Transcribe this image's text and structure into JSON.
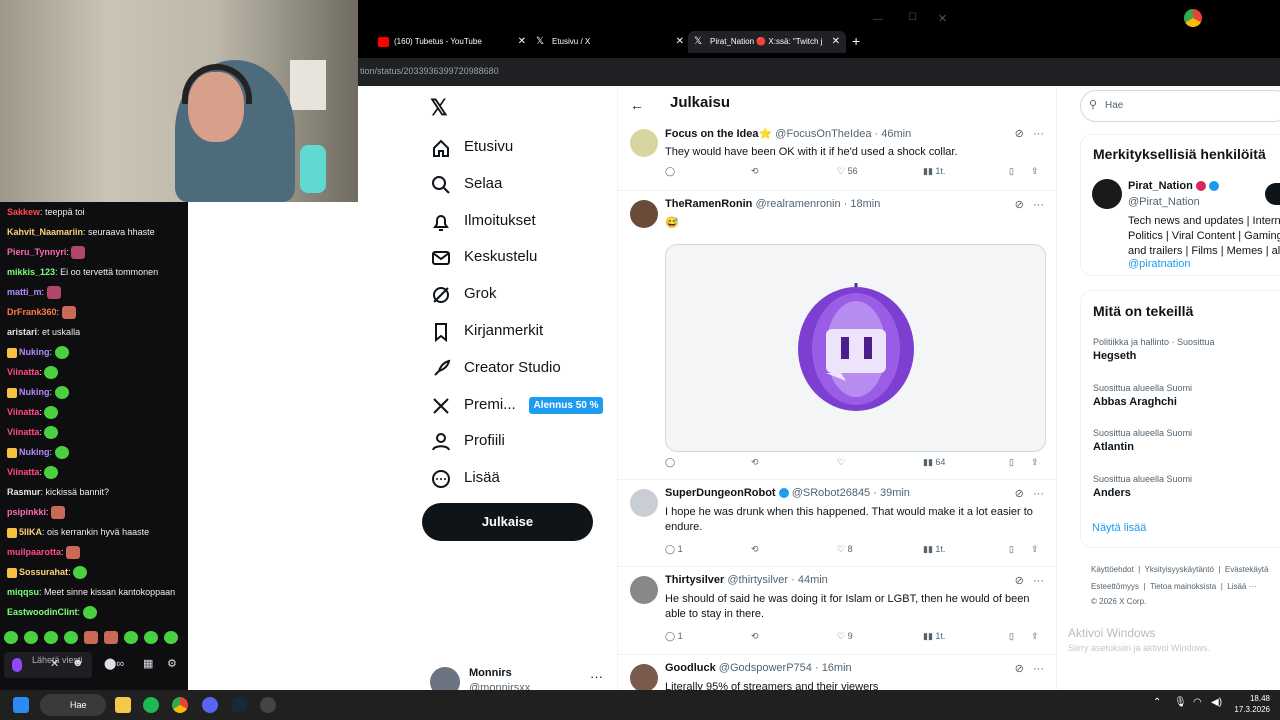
{
  "stream": {
    "chat": [
      {
        "user": "Sakkew",
        "color": "#ff4a4a",
        "text": "teeppä toi"
      },
      {
        "user": "Kahvit_Naamariin",
        "color": "#ffd27a",
        "text": "seuraava hhaste"
      },
      {
        "user": "Pieru_Tynnyri",
        "color": "#ff69b4",
        "text": ""
      },
      {
        "user": "mikkis_123",
        "color": "#7cff7c",
        "text": "Ei oo tervettä tommonen"
      },
      {
        "user": "matti_m",
        "color": "#b18cff",
        "text": ""
      },
      {
        "user": "DrFrank360",
        "color": "#ff7b4a",
        "text": ""
      },
      {
        "user": "aristari",
        "color": "#e6e6e6",
        "text": "et uskalla"
      },
      {
        "user": "Nuking",
        "color": "#b18cff",
        "text": ""
      },
      {
        "user": "Viinatta",
        "color": "#ff4a8a",
        "text": ""
      },
      {
        "user": "Nuking",
        "color": "#b18cff",
        "text": ""
      },
      {
        "user": "Viinatta",
        "color": "#ff4a8a",
        "text": ""
      },
      {
        "user": "Viinatta",
        "color": "#ff4a8a",
        "text": ""
      },
      {
        "user": "Nuking",
        "color": "#b18cff",
        "text": ""
      },
      {
        "user": "Viinatta",
        "color": "#ff4a8a",
        "text": ""
      },
      {
        "user": "Rasmur",
        "color": "#e6e6e6",
        "text": "kickissä bannit?"
      },
      {
        "user": "psipinkki",
        "color": "#ff69b4",
        "text": ""
      },
      {
        "user": "5IIKA",
        "color": "#ffd27a",
        "text": "ois kerrankin hyvä haaste"
      },
      {
        "user": "muilpaarotta",
        "color": "#ff4a8a",
        "text": ""
      },
      {
        "user": "Sossurahat",
        "color": "#ffd27a",
        "text": ""
      },
      {
        "user": "miqqsu",
        "color": "#7cff7c",
        "text": "Meet sinne kissan kantokoppaan"
      },
      {
        "user": "EastwoodinClint",
        "color": "#7cff7c",
        "text": ""
      }
    ],
    "send_placeholder": "Lähetä viesti"
  },
  "browser": {
    "tabs": [
      {
        "label": "(160) Tubetus - YouTube",
        "icon": "youtube-icon"
      },
      {
        "label": "Etusivu / X",
        "icon": "x-logo-icon"
      },
      {
        "label": "Pirat_Nation 🔴 X:ssä: \"Twitch j",
        "icon": "x-logo-icon"
      }
    ],
    "url": "tion/status/2033936399720988680"
  },
  "x": {
    "nav": [
      {
        "label": "Etusivu",
        "icon": "home-icon"
      },
      {
        "label": "Selaa",
        "icon": "search-icon"
      },
      {
        "label": "Ilmoitukset",
        "icon": "bell-icon"
      },
      {
        "label": "Keskustelu",
        "icon": "mail-icon"
      },
      {
        "label": "Grok",
        "icon": "grok-icon"
      },
      {
        "label": "Kirjanmerkit",
        "icon": "bookmark-icon"
      },
      {
        "label": "Creator Studio",
        "icon": "rocket-icon"
      },
      {
        "label": "Premi...",
        "icon": "x-logo-icon"
      },
      {
        "label": "Profiili",
        "icon": "person-icon"
      },
      {
        "label": "Lisää",
        "icon": "more-icon"
      }
    ],
    "premium_badge": "Alennus 50 %",
    "post_button": "Julkaise",
    "account": {
      "name": "Monnirs",
      "handle": "@monnirsxx"
    },
    "header_title": "Julkaisu",
    "tweets": [
      {
        "name": "Focus on the Idea⭐",
        "handle": "@FocusOnTheIdea",
        "time": "46min",
        "text": "They would have been OK with it if he'd used a shock collar.",
        "replies": "",
        "retweets": "",
        "likes": "56",
        "views": "1t."
      },
      {
        "name": "TheRamenRonin",
        "handle": "@realramenronin",
        "time": "18min",
        "text": "😅",
        "replies": "",
        "retweets": "",
        "likes": "",
        "views": "64"
      },
      {
        "name": "SuperDungeonRobot",
        "handle": "@SRobot26845",
        "time": "39min",
        "text": "I hope he was drunk when this happened. That would make it a lot easier to endure.",
        "replies": "1",
        "retweets": "",
        "likes": "8",
        "views": "1t."
      },
      {
        "name": "Thirtysilver",
        "handle": "@thirtysilver",
        "time": "44min",
        "text": "He should of said he was doing it for Islam or LGBT, then he would of been able to stay in there.",
        "replies": "1",
        "retweets": "",
        "likes": "9",
        "views": "1t."
      },
      {
        "name": "Goodluck",
        "handle": "@GodspowerP754",
        "time": "16min",
        "text": "Literally 95% of streamers and their viewers",
        "replies": "",
        "retweets": "",
        "likes": "",
        "views": ""
      }
    ],
    "search_placeholder": "Hae",
    "relevant": {
      "title": "Merkityksellisiä henkilöitä",
      "name": "Pirat_Nation",
      "handle": "@Pirat_Nation",
      "bio": "Tech news and updates | Internet Politics | Viral Content | Gaming and trailers | Films | Memes | all",
      "bio_link": "@piratnation"
    },
    "trends": {
      "title": "Mitä on tekeillä",
      "items": [
        {
          "context": "Politiikka ja hallinto · Suosittua",
          "topic": "Hegseth"
        },
        {
          "context": "Suosittua alueella Suomi",
          "topic": "Abbas Araghchi"
        },
        {
          "context": "Suosittua alueella Suomi",
          "topic": "Atlantin"
        },
        {
          "context": "Suosittua alueella Suomi",
          "topic": "Anders"
        }
      ],
      "show_more": "Näytä lisää"
    },
    "footer": [
      "Käyttöehdot",
      "Yksityisyyskäytäntö",
      "Evästekäytä",
      "Esteettömyys",
      "Tietoa mainoksista",
      "Lisää ···",
      "© 2026 X Corp."
    ]
  },
  "windows": {
    "activate_title": "Aktivoi Windows",
    "activate_sub": "Siirry asetuksiin ja aktivoi Windows.",
    "search": "Hae",
    "time": "18.48",
    "date": "17.3.2026"
  }
}
